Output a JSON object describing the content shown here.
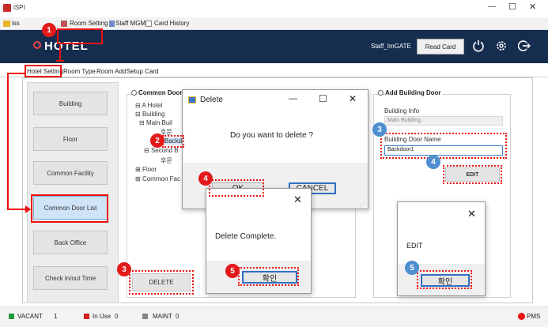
{
  "window": {
    "title": "iSPI",
    "controls": {
      "minimize": "—",
      "maximize": "☐",
      "close": "✕"
    }
  },
  "menubar": {
    "items": [
      {
        "label": "iss"
      },
      {
        "label": "Room Setting"
      },
      {
        "label": "Staff MGMT"
      },
      {
        "label": "Card History"
      }
    ]
  },
  "header": {
    "logo": "HOTEL",
    "user": "Staff_ImGATE",
    "read_card": "Read Card",
    "bg_color": "#152d4e"
  },
  "tabs": [
    "Hotel Setting",
    "Room Type",
    "Room Add",
    "Setup Card"
  ],
  "sidebar": {
    "items": [
      {
        "label": "Building"
      },
      {
        "label": "Floor"
      },
      {
        "label": "Common Facility"
      },
      {
        "label": "Common Door List"
      },
      {
        "label": "Back Office"
      },
      {
        "label": "Check in/out Time"
      }
    ]
  },
  "tree": {
    "group_title": "Common Door Li",
    "nodes": [
      {
        "label": "A Hotel",
        "prefix": "⊟"
      },
      {
        "label": "Building",
        "prefix": "⊟"
      },
      {
        "label": "Main Buil",
        "prefix": "⊟"
      },
      {
        "label": "후문",
        "prefix": ""
      },
      {
        "label": "Backd",
        "prefix": ""
      },
      {
        "label": "Second B",
        "prefix": "⊟"
      },
      {
        "label": "후문",
        "prefix": ""
      },
      {
        "label": "Floor",
        "prefix": "⊞"
      },
      {
        "label": "Common Fac",
        "prefix": "⊞"
      }
    ],
    "delete_button": "DELETE"
  },
  "add_door": {
    "title": "Add Building Door",
    "info_label": "Building Info",
    "info_value": "Main Building",
    "name_label": "Building Door Name",
    "name_value": "Backdoor1",
    "edit_button": "EDIT"
  },
  "delete_dialog": {
    "title": "Delete",
    "message": "Do you want to delete ?",
    "ok": "OK",
    "cancel": "CANCEL"
  },
  "complete_dialog": {
    "message": "Delete Complete.",
    "ok": "확인"
  },
  "edit_dialog": {
    "message": "EDIT",
    "ok": "확인"
  },
  "status": {
    "vacant_label": "VACANT",
    "vacant_count": "1",
    "inuse_label": "In Use",
    "inuse_count": "0",
    "maint_label": "MAINT",
    "maint_count": "0",
    "pms": "PMS"
  },
  "steps": {
    "s1": "1",
    "s2": "2",
    "s3a": "3",
    "s3b": "3",
    "s4a": "4",
    "s4b": "4",
    "s5a": "5",
    "s5b": "5"
  },
  "colors": {
    "highlight": "#e11111",
    "step_red": "#e41a1a",
    "step_blue": "#4f8fd0",
    "selected_item": "#cfe4f7"
  }
}
